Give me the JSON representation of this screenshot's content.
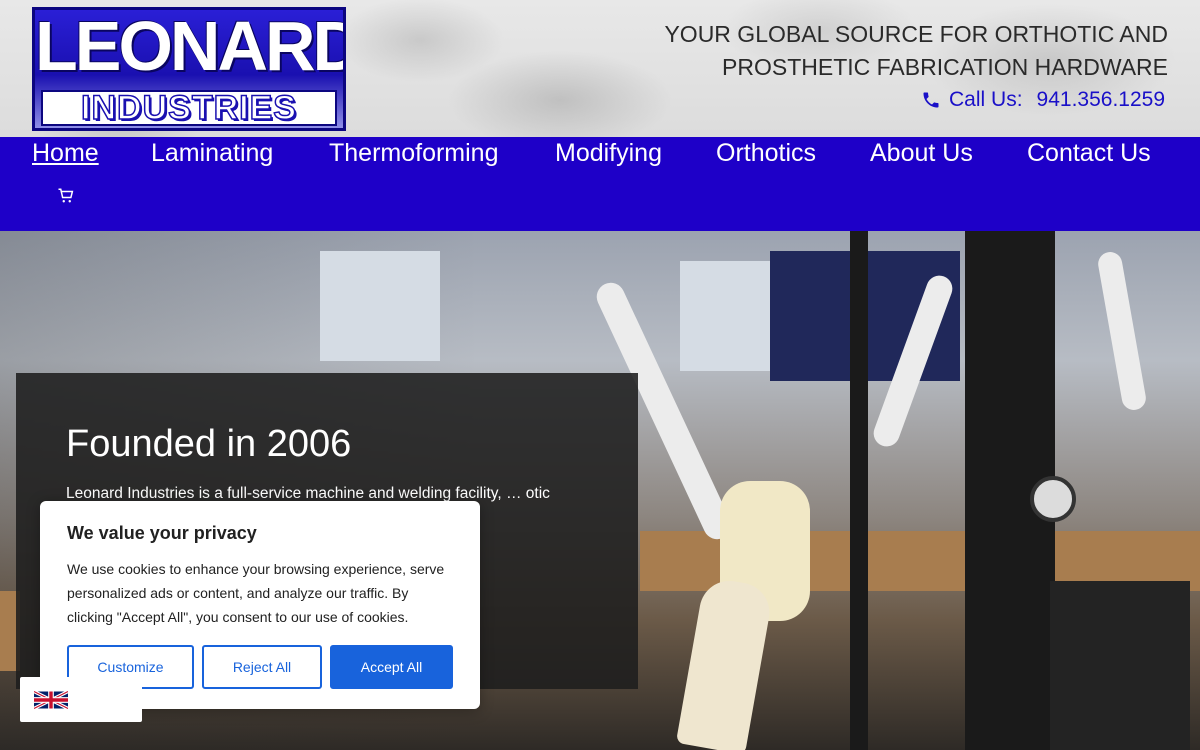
{
  "logo": {
    "line1": "LEONARD",
    "line2": "INDUSTRIES"
  },
  "header": {
    "tagline_line1": "YOUR GLOBAL SOURCE FOR ORTHOTIC AND",
    "tagline_line2": "PROSTHETIC FABRICATION HARDWARE",
    "call_label": "Call Us:",
    "phone": "941.356.1259",
    "phone_icon": "phone-icon"
  },
  "nav": {
    "items": [
      {
        "label": "Home",
        "active": true
      },
      {
        "label": "Laminating"
      },
      {
        "label": "Thermoforming"
      },
      {
        "label": "Modifying"
      },
      {
        "label": "Orthotics"
      },
      {
        "label": "About Us"
      },
      {
        "label": "Contact Us"
      }
    ],
    "cart_icon": "cart-icon"
  },
  "hero": {
    "title": "Founded in 2006",
    "text": "Leonard Industries is a full-service machine and welding facility, … otic and"
  },
  "cookie": {
    "title": "We value your privacy",
    "body": "We use cookies to enhance your browsing experience, serve personalized ads or content, and analyze our traffic. By clicking \"Accept All\", you consent to our use of cookies.",
    "customize": "Customize",
    "reject": "Reject All",
    "accept": "Accept All"
  },
  "colors": {
    "nav_bg": "#1e00c8",
    "accent": "#1863dc",
    "phone": "#1a10c8"
  }
}
